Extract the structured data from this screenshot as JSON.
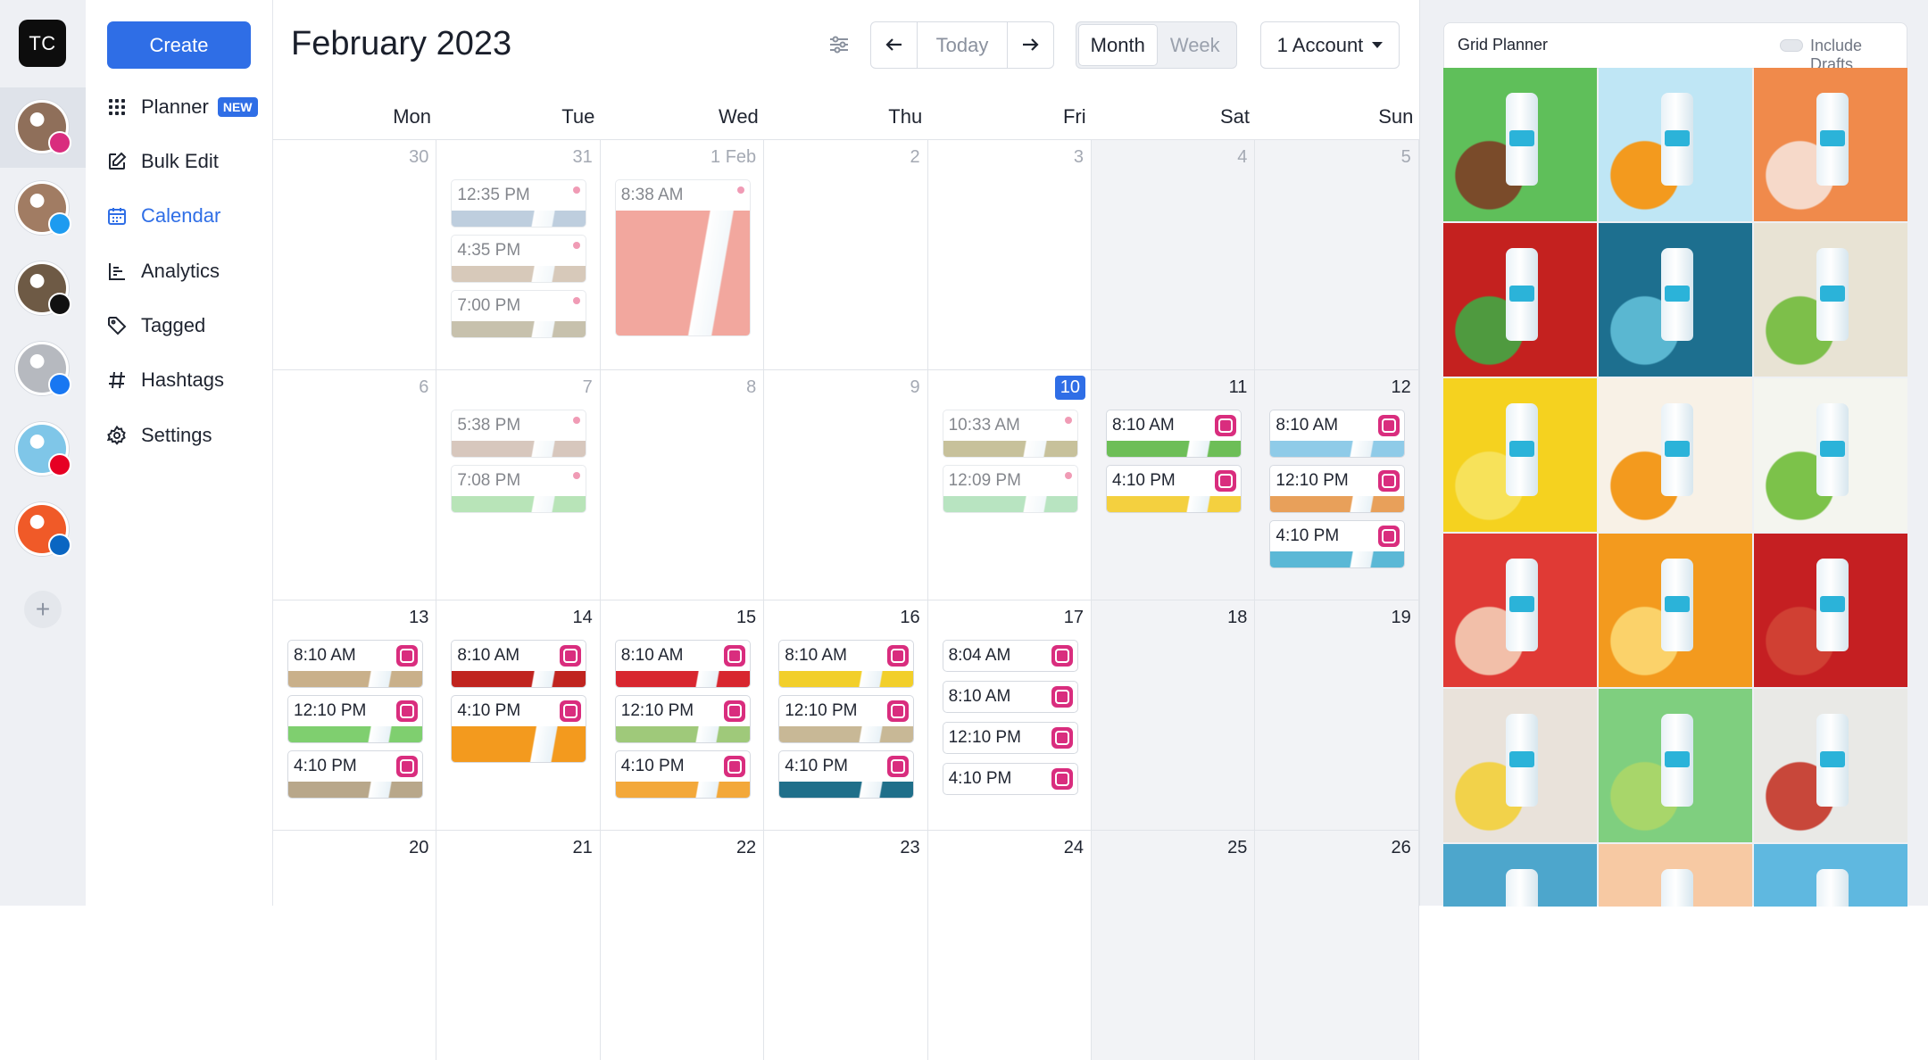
{
  "rail": {
    "brand_initials": "TC",
    "accounts": [
      {
        "name": "instagram",
        "color": "#8f6f5a",
        "badge_color": "#d92d7e",
        "badge": "instagram-badge-icon"
      },
      {
        "name": "twitter",
        "color": "#a17c63",
        "badge_color": "#1d9bf0",
        "badge": "twitter-badge-icon"
      },
      {
        "name": "tiktok",
        "color": "#6e5a45",
        "badge_color": "#111111",
        "badge": "tiktok-badge-icon"
      },
      {
        "name": "facebook",
        "color": "#b6b9bf",
        "badge_color": "#1877f2",
        "badge": "facebook-badge-icon"
      },
      {
        "name": "pinterest",
        "color": "#7fc6e8",
        "badge_color": "#e60023",
        "badge": "pinterest-badge-icon"
      },
      {
        "name": "linkedin",
        "color": "#f05a28",
        "badge_color": "#0a66c2",
        "badge": "linkedin-badge-icon"
      }
    ]
  },
  "sidebar": {
    "create_label": "Create",
    "new_badge": "NEW",
    "items": [
      {
        "label": "Planner",
        "icon": "grid-icon"
      },
      {
        "label": "Bulk Edit",
        "icon": "edit-icon"
      },
      {
        "label": "Calendar",
        "icon": "calendar-icon"
      },
      {
        "label": "Analytics",
        "icon": "analytics-icon"
      },
      {
        "label": "Tagged",
        "icon": "tag-icon"
      },
      {
        "label": "Hashtags",
        "icon": "hashtag-icon"
      },
      {
        "label": "Settings",
        "icon": "settings-icon"
      }
    ]
  },
  "header": {
    "title": "February 2023",
    "today_label": "Today",
    "month_label": "Month",
    "week_label": "Week",
    "account_label": "1 Account"
  },
  "weekdays": [
    "Mon",
    "Tue",
    "Wed",
    "Thu",
    "Fri",
    "Sat",
    "Sun"
  ],
  "weeks": [
    [
      {
        "day": "30",
        "muted": true,
        "posts": []
      },
      {
        "day": "31",
        "muted": true,
        "posts": [
          {
            "time": "12:35 PM",
            "kind": "draft",
            "color": "#8aa7c4"
          },
          {
            "time": "4:35 PM",
            "kind": "draft",
            "color": "#b79d83"
          },
          {
            "time": "7:00 PM",
            "kind": "draft",
            "color": "#9a8f6b"
          }
        ]
      },
      {
        "day": "1 Feb",
        "muted": true,
        "posts": [
          {
            "time": "8:38 AM",
            "kind": "draft-large",
            "color": "#e8604f"
          }
        ]
      },
      {
        "day": "2",
        "muted": true,
        "posts": []
      },
      {
        "day": "3",
        "muted": true,
        "posts": []
      },
      {
        "day": "4",
        "muted": true,
        "posts": []
      },
      {
        "day": "5",
        "muted": true,
        "posts": []
      }
    ],
    [
      {
        "day": "6",
        "muted": true,
        "posts": []
      },
      {
        "day": "7",
        "muted": true,
        "posts": [
          {
            "time": "5:38 PM",
            "kind": "draft",
            "color": "#b89a88"
          },
          {
            "time": "7:08 PM",
            "kind": "draft",
            "color": "#7fcf7f"
          }
        ]
      },
      {
        "day": "8",
        "muted": true,
        "posts": []
      },
      {
        "day": "9",
        "muted": true,
        "posts": []
      },
      {
        "day": "10",
        "today": true,
        "posts": [
          {
            "time": "10:33 AM",
            "kind": "draft",
            "color": "#9a8f4a"
          },
          {
            "time": "12:09 PM",
            "kind": "draft",
            "color": "#7fcf8f"
          }
        ]
      },
      {
        "day": "11",
        "posts": [
          {
            "time": "8:10 AM",
            "kind": "ig",
            "color": "#6dbe57"
          },
          {
            "time": "4:10 PM",
            "kind": "ig",
            "color": "#f4d03f"
          }
        ]
      },
      {
        "day": "12",
        "posts": [
          {
            "time": "8:10 AM",
            "kind": "ig",
            "color": "#8fcbe8"
          },
          {
            "time": "12:10 PM",
            "kind": "ig",
            "color": "#e8a05a"
          },
          {
            "time": "4:10 PM",
            "kind": "ig",
            "color": "#5bb8d6"
          }
        ]
      }
    ],
    [
      {
        "day": "13",
        "posts": [
          {
            "time": "8:10 AM",
            "kind": "ig",
            "color": "#c9b08a"
          },
          {
            "time": "12:10 PM",
            "kind": "ig",
            "color": "#7fcf6f"
          },
          {
            "time": "4:10 PM",
            "kind": "ig",
            "color": "#b8a78a"
          }
        ]
      },
      {
        "day": "14",
        "posts": [
          {
            "time": "8:10 AM",
            "kind": "ig",
            "color": "#c0241f"
          },
          {
            "time": "4:10 PM",
            "kind": "ig-tall",
            "color": "#f39a1e"
          }
        ]
      },
      {
        "day": "15",
        "posts": [
          {
            "time": "8:10 AM",
            "kind": "ig",
            "color": "#d8262f"
          },
          {
            "time": "12:10 PM",
            "kind": "ig",
            "color": "#9fc97a"
          },
          {
            "time": "4:10 PM",
            "kind": "ig",
            "color": "#f3a83a"
          }
        ]
      },
      {
        "day": "16",
        "posts": [
          {
            "time": "8:10 AM",
            "kind": "ig",
            "color": "#f2cf2a"
          },
          {
            "time": "12:10 PM",
            "kind": "ig",
            "color": "#c8b896"
          },
          {
            "time": "4:10 PM",
            "kind": "ig",
            "color": "#1f6f8a"
          }
        ]
      },
      {
        "day": "17",
        "posts": [
          {
            "time": "8:04 AM",
            "kind": "ig-notime",
            "color": ""
          },
          {
            "time": "8:10 AM",
            "kind": "ig-notime",
            "color": ""
          },
          {
            "time": "12:10 PM",
            "kind": "ig-notime",
            "color": ""
          },
          {
            "time": "4:10 PM",
            "kind": "ig-notime",
            "color": ""
          }
        ]
      },
      {
        "day": "18",
        "posts": []
      },
      {
        "day": "19",
        "posts": []
      }
    ],
    [
      {
        "day": "20",
        "posts": []
      },
      {
        "day": "21",
        "posts": []
      },
      {
        "day": "22",
        "posts": []
      },
      {
        "day": "23",
        "posts": []
      },
      {
        "day": "24",
        "posts": []
      },
      {
        "day": "25",
        "posts": []
      },
      {
        "day": "26",
        "posts": []
      }
    ]
  ],
  "grid_planner": {
    "title": "Grid Planner",
    "drafts_label": "Include Drafts",
    "tiles": [
      {
        "bg": "#5fbf5a",
        "accent": "#7a4b2a"
      },
      {
        "bg": "#bfe6f5",
        "accent": "#f39a1e"
      },
      {
        "bg": "#f08a4b",
        "accent": "#f6d9c9"
      },
      {
        "bg": "#c4211f",
        "accent": "#4f9a3f"
      },
      {
        "bg": "#1d6f8f",
        "accent": "#5ab7d1"
      },
      {
        "bg": "#e8e3d4",
        "accent": "#7dbf4a"
      },
      {
        "bg": "#f5d21f",
        "accent": "#f7e25a"
      },
      {
        "bg": "#f8f1e6",
        "accent": "#f39a1e"
      },
      {
        "bg": "#f4f5ef",
        "accent": "#7cc24a"
      },
      {
        "bg": "#e03a35",
        "accent": "#f2bfa9"
      },
      {
        "bg": "#f39a1e",
        "accent": "#fbd26a"
      },
      {
        "bg": "#c51f22",
        "accent": "#d04033"
      },
      {
        "bg": "#e9e2da",
        "accent": "#f2d24a"
      },
      {
        "bg": "#7fcf7f",
        "accent": "#a8d66a"
      },
      {
        "bg": "#e9e9e6",
        "accent": "#c8473a"
      },
      {
        "bg": "#4da6cc",
        "accent": "#bfe4f2"
      },
      {
        "bg": "#f7c9a3",
        "accent": "#e36a3a"
      },
      {
        "bg": "#5fb8e0",
        "accent": "#a4dcf0"
      }
    ]
  }
}
